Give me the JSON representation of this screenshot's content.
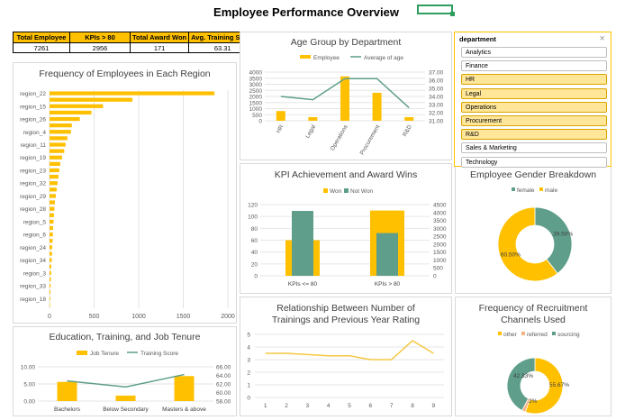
{
  "title": "Employee Performance Overview",
  "kpi_table": {
    "headers": [
      "Total Employee",
      "KPIs > 80",
      "Total Award Won",
      "Avg. Training Score"
    ],
    "values": [
      "7261",
      "2956",
      "171",
      "63.31"
    ]
  },
  "colors": {
    "accent": "#ffc000",
    "bar": "#ffc000",
    "green": "#5e9e8a",
    "line_green": "#5e9e8a",
    "yellow_line": "#f5c842"
  },
  "slicer": {
    "title": "department",
    "clear_icon": "clear-filter-icon",
    "items": [
      {
        "label": "Analytics",
        "selected": false
      },
      {
        "label": "Finance",
        "selected": false
      },
      {
        "label": "HR",
        "selected": true
      },
      {
        "label": "Legal",
        "selected": true
      },
      {
        "label": "Operations",
        "selected": true
      },
      {
        "label": "Procurement",
        "selected": true
      },
      {
        "label": "R&D",
        "selected": true
      },
      {
        "label": "Sales & Marketing",
        "selected": false
      },
      {
        "label": "Technology",
        "selected": false
      }
    ]
  },
  "region_chart": {
    "title": "Frequency of Employees in Each Region",
    "categories": [
      "region_22",
      "region_15",
      "region_26",
      "region_4",
      "region_11",
      "region_19",
      "region_23",
      "region_32",
      "region_29",
      "region_28",
      "region_5",
      "region_6",
      "region_24",
      "region_34",
      "region_3",
      "region_33",
      "region_18"
    ],
    "values": [
      1850,
      930,
      600,
      470,
      340,
      250,
      240,
      200,
      180,
      165,
      140,
      120,
      110,
      100,
      90,
      80,
      70,
      60,
      55,
      50,
      45,
      40,
      38,
      35,
      30,
      28,
      25,
      20,
      18,
      15,
      12,
      10,
      8,
      6
    ],
    "x_ticks": [
      "0",
      "500",
      "1000",
      "1500",
      "2000"
    ],
    "xlim": [
      0,
      2000
    ]
  },
  "age_chart": {
    "title": "Age Group by Department",
    "legend": [
      "Employee",
      "Average of age"
    ],
    "categories": [
      "HR",
      "Legal",
      "Operations",
      "Procurement",
      "R&D"
    ],
    "employee": [
      800,
      300,
      3650,
      2300,
      300
    ],
    "avg_age": [
      34.0,
      33.6,
      36.2,
      36.2,
      32.6
    ],
    "y_left_ticks": [
      "0",
      "500",
      "1000",
      "1500",
      "2000",
      "2500",
      "3000",
      "3500",
      "4000"
    ],
    "y_right_ticks": [
      "31.00",
      "32.00",
      "33.00",
      "34.00",
      "35.00",
      "36.00",
      "37.00"
    ],
    "ylim_left": [
      0,
      4000
    ],
    "ylim_right": [
      31,
      37
    ]
  },
  "kpi_chart": {
    "title": "KPI Achievement and Award Wins",
    "legend": [
      "Won",
      "Not Won"
    ],
    "categories": [
      "KPIs <= 80",
      "KPIs > 80"
    ],
    "won": [
      60,
      110
    ],
    "not_won": [
      4100,
      2700
    ],
    "y_left_ticks": [
      "0",
      "20",
      "40",
      "60",
      "80",
      "100",
      "120"
    ],
    "y_right_ticks": [
      "0",
      "500",
      "1000",
      "1500",
      "2000",
      "2500",
      "3000",
      "3500",
      "4000",
      "4500"
    ],
    "ylim_left": [
      0,
      120
    ],
    "ylim_right": [
      0,
      4500
    ]
  },
  "gender_chart": {
    "title": "Employee Gender Breakdown",
    "legend": [
      "female",
      "male"
    ],
    "values": [
      39.5,
      60.5
    ],
    "labels": [
      "39.50%",
      "60.50%"
    ]
  },
  "education_chart": {
    "title": "Education, Training, and Job Tenure",
    "legend": [
      "Job Tenure",
      "Training Score"
    ],
    "categories": [
      "Bachelors",
      "Below Secondary",
      "Masters & above"
    ],
    "tenure": [
      5.6,
      1.6,
      7.3
    ],
    "training": [
      62.7,
      61.3,
      64.2
    ],
    "y_left_ticks": [
      "0.00",
      "5.00",
      "10.00"
    ],
    "y_right_ticks": [
      "58.00",
      "60.00",
      "62.00",
      "64.00",
      "66.00"
    ],
    "ylim_left": [
      0,
      10
    ],
    "ylim_right": [
      58,
      66
    ]
  },
  "rating_chart": {
    "title_line1": "Relationship Between Number of",
    "title_line2": "Trainings and Previous Year Rating",
    "x": [
      "1",
      "2",
      "3",
      "4",
      "5",
      "6",
      "7",
      "8",
      "9"
    ],
    "y": [
      3.5,
      3.5,
      3.4,
      3.3,
      3.3,
      3.0,
      3.0,
      4.5,
      3.5
    ],
    "y_ticks": [
      "0",
      "1",
      "2",
      "3",
      "4",
      "5"
    ],
    "ylim": [
      0,
      5
    ]
  },
  "recruit_chart": {
    "title_line1": "Frequency of Recruitment",
    "title_line2": "Channels Used",
    "legend": [
      "other",
      "referred",
      "sourcing"
    ],
    "values": [
      55.67,
      2.0,
      42.33
    ],
    "labels": [
      "55.67%",
      "2%",
      "42.33%"
    ]
  }
}
